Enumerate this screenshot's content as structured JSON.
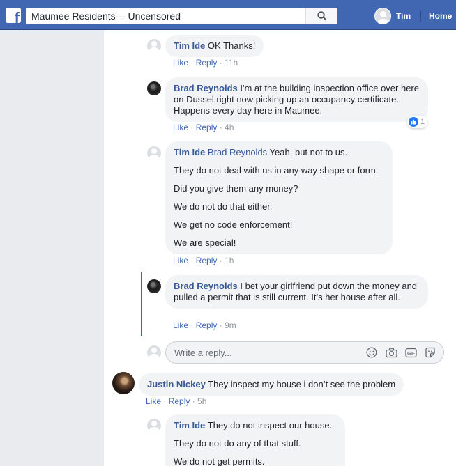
{
  "topbar": {
    "logo": "f",
    "search_value": "Maumee Residents--- Uncensored",
    "user_name": "Tim",
    "home_label": "Home"
  },
  "comments": [
    {
      "author": "Tim Ide",
      "lines": [
        "OK Thanks!"
      ],
      "like": "Like",
      "reply": "Reply",
      "time": "11h"
    },
    {
      "author": "Brad Reynolds",
      "lines": [
        "I'm at the building inspection office over here on Dussel right now picking up an occupancy certificate. Happens every day here in Maumee."
      ],
      "like": "Like",
      "reply": "Reply",
      "time": "4h",
      "reaction_count": "1"
    },
    {
      "author": "Tim Ide",
      "tag": "Brad Reynolds",
      "lines": [
        "Yeah, but not to us.",
        "They do not deal with us in any way shape or form.",
        "Did you give them any money?",
        "We do not do that either.",
        "We get no code enforcement!",
        "We are special!"
      ],
      "like": "Like",
      "reply": "Reply",
      "time": "1h"
    },
    {
      "author": "Brad Reynolds",
      "lines": [
        "I bet your girlfriend put down the money and pulled a permit that is still current. It’s her house after all."
      ],
      "like": "Like",
      "reply": "Reply",
      "time": "9m"
    },
    {
      "author": "Justin Nickey",
      "lines": [
        "They inspect my house i don’t see the problem"
      ],
      "like": "Like",
      "reply": "Reply",
      "time": "5h"
    },
    {
      "author": "Tim Ide",
      "lines": [
        "They do not inspect our house.",
        "They do not do any of that stuff.",
        "We do not get permits."
      ]
    }
  ],
  "reply_box": {
    "placeholder": "Write a reply..."
  },
  "colors": {
    "brand": "#4267b2",
    "link": "#385898",
    "bubble": "#f2f3f5",
    "like_blue": "#2078f4"
  },
  "icons": [
    "facebook-logo-icon",
    "search-icon",
    "profile-avatar-icon",
    "like-reaction-icon",
    "emoji-icon",
    "camera-icon",
    "gif-icon",
    "sticker-icon"
  ]
}
